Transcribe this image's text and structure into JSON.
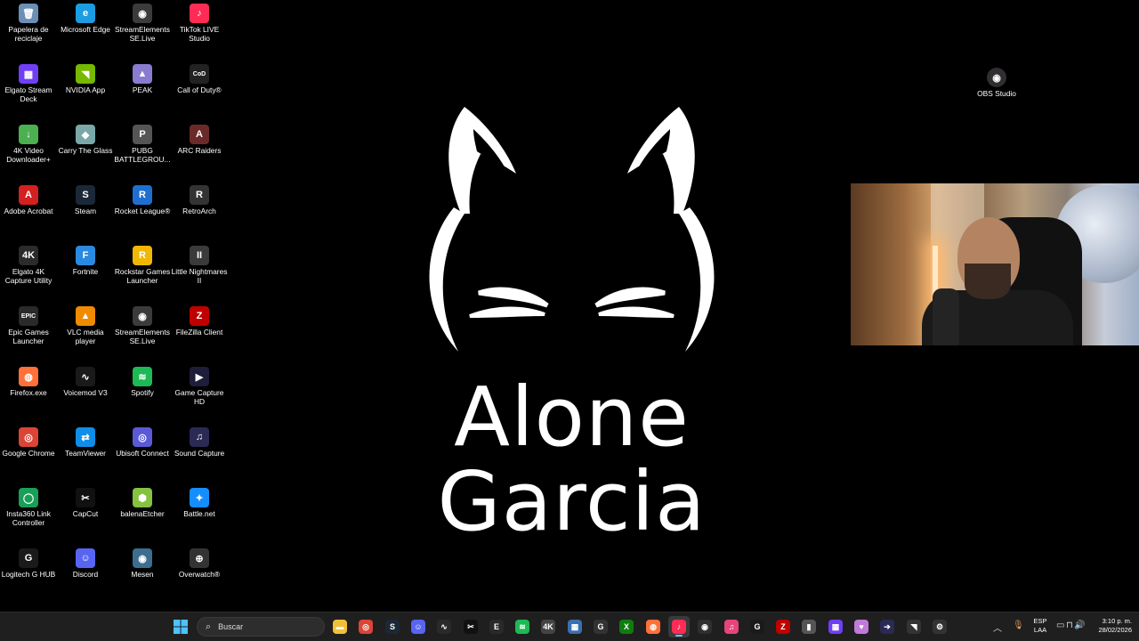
{
  "desktop": {
    "icons": [
      {
        "label": "Papelera de reciclaje",
        "icon": "recycle-bin-icon",
        "glyph": "🗑",
        "color": "#6b8fb5"
      },
      {
        "label": "Microsoft Edge",
        "icon": "edge-icon",
        "glyph": "e",
        "color": "#1b9de2"
      },
      {
        "label": "StreamElements SE.Live",
        "icon": "streamelements-icon",
        "glyph": "◉",
        "color": "#3b3b3b"
      },
      {
        "label": "TikTok LIVE Studio",
        "icon": "tiktok-live-icon",
        "glyph": "♪",
        "color": "#fe2c55"
      },
      {
        "label": "Elgato Stream Deck",
        "icon": "stream-deck-icon",
        "glyph": "▦",
        "color": "#6f3ff5"
      },
      {
        "label": "NVIDIA App",
        "icon": "nvidia-icon",
        "glyph": "◥",
        "color": "#76b900"
      },
      {
        "label": "PEAK",
        "icon": "peak-icon",
        "glyph": "▲",
        "color": "#8a7bd1"
      },
      {
        "label": "Call of Duty®",
        "icon": "call-of-duty-icon",
        "glyph": "CoD",
        "color": "#222222"
      },
      {
        "label": "4K Video Downloader+",
        "icon": "4k-video-downloader-icon",
        "glyph": "↓",
        "color": "#4caf50"
      },
      {
        "label": "Carry The Glass",
        "icon": "carry-the-glass-icon",
        "glyph": "◆",
        "color": "#7aa7a8"
      },
      {
        "label": "PUBG BATTLEGROU...",
        "icon": "pubg-icon",
        "glyph": "P",
        "color": "#555555"
      },
      {
        "label": "ARC Raiders",
        "icon": "arc-raiders-icon",
        "glyph": "A",
        "color": "#6b2a2a"
      },
      {
        "label": "Adobe Acrobat",
        "icon": "adobe-acrobat-icon",
        "glyph": "A",
        "color": "#d32020"
      },
      {
        "label": "Steam",
        "icon": "steam-icon",
        "glyph": "S",
        "color": "#1b2838"
      },
      {
        "label": "Rocket League®",
        "icon": "rocket-league-icon",
        "glyph": "R",
        "color": "#1f6fd1"
      },
      {
        "label": "RetroArch",
        "icon": "retroarch-icon",
        "glyph": "R",
        "color": "#333333"
      },
      {
        "label": "Elgato 4K Capture Utility",
        "icon": "elgato-capture-icon",
        "glyph": "4K",
        "color": "#2b2b2b"
      },
      {
        "label": "Fortnite",
        "icon": "fortnite-icon",
        "glyph": "F",
        "color": "#2a8ae0"
      },
      {
        "label": "Rockstar Games Launcher",
        "icon": "rockstar-icon",
        "glyph": "R",
        "color": "#f2b705"
      },
      {
        "label": "Little Nightmares II",
        "icon": "little-nightmares-icon",
        "glyph": "II",
        "color": "#3a3a3a"
      },
      {
        "label": "Epic Games Launcher",
        "icon": "epic-games-icon",
        "glyph": "EPIC",
        "color": "#2a2a2a"
      },
      {
        "label": "VLC media player",
        "icon": "vlc-icon",
        "glyph": "▲",
        "color": "#f08a00"
      },
      {
        "label": "StreamElements SE.Live",
        "icon": "streamelements-icon",
        "glyph": "◉",
        "color": "#3b3b3b"
      },
      {
        "label": "FileZilla Client",
        "icon": "filezilla-icon",
        "glyph": "Z",
        "color": "#bf0000"
      },
      {
        "label": "Firefox.exe",
        "icon": "firefox-icon",
        "glyph": "◍",
        "color": "#ff7139"
      },
      {
        "label": "Voicemod V3",
        "icon": "voicemod-icon",
        "glyph": "∿",
        "color": "#1a1a1a"
      },
      {
        "label": "Spotify",
        "icon": "spotify-icon",
        "glyph": "≋",
        "color": "#1db954"
      },
      {
        "label": "Game Capture HD",
        "icon": "game-capture-icon",
        "glyph": "▶",
        "color": "#1e1e3a"
      },
      {
        "label": "Google Chrome",
        "icon": "chrome-icon",
        "glyph": "◎",
        "color": "#db4437"
      },
      {
        "label": "TeamViewer",
        "icon": "teamviewer-icon",
        "glyph": "⇄",
        "color": "#0e8ee9"
      },
      {
        "label": "Ubisoft Connect",
        "icon": "ubisoft-icon",
        "glyph": "◎",
        "color": "#5a5ad6"
      },
      {
        "label": "Sound Capture",
        "icon": "sound-capture-icon",
        "glyph": "♫",
        "color": "#2a2a55"
      },
      {
        "label": "Insta360 Link Controller",
        "icon": "insta360-icon",
        "glyph": "◯",
        "color": "#18a058"
      },
      {
        "label": "CapCut",
        "icon": "capcut-icon",
        "glyph": "✂",
        "color": "#111111"
      },
      {
        "label": "balenaEtcher",
        "icon": "balena-etcher-icon",
        "glyph": "⬢",
        "color": "#85c240"
      },
      {
        "label": "Battle.net",
        "icon": "battlenet-icon",
        "glyph": "✦",
        "color": "#148eff"
      },
      {
        "label": "Logitech G HUB",
        "icon": "logitech-ghub-icon",
        "glyph": "G",
        "color": "#1a1a1a"
      },
      {
        "label": "Discord",
        "icon": "discord-icon",
        "glyph": "☺",
        "color": "#5865f2"
      },
      {
        "label": "Mesen",
        "icon": "mesen-icon",
        "glyph": "◉",
        "color": "#3c6e8f"
      },
      {
        "label": "Overwatch®",
        "icon": "overwatch-icon",
        "glyph": "⊕",
        "color": "#333333"
      }
    ],
    "obs": {
      "label": "OBS Studio",
      "icon": "obs-icon",
      "glyph": "◉",
      "color": "#302e31"
    }
  },
  "wallpaper": {
    "line1": "Alone",
    "line2": "Garcia"
  },
  "taskbar": {
    "search_placeholder": "Buscar",
    "apps": [
      {
        "name": "file-explorer-icon",
        "glyph": "▬",
        "color": "#f2c037"
      },
      {
        "name": "chrome-icon",
        "glyph": "◎",
        "color": "#db4437"
      },
      {
        "name": "steam-icon",
        "glyph": "S",
        "color": "#1b2838"
      },
      {
        "name": "discord-icon",
        "glyph": "☺",
        "color": "#5865f2"
      },
      {
        "name": "voicemod-icon",
        "glyph": "∿",
        "color": "#2a2a2a"
      },
      {
        "name": "capcut-icon",
        "glyph": "✂",
        "color": "#111111"
      },
      {
        "name": "epic-games-icon",
        "glyph": "E",
        "color": "#2a2a2a"
      },
      {
        "name": "spotify-icon",
        "glyph": "≋",
        "color": "#1db954"
      },
      {
        "name": "elgato-4k-icon",
        "glyph": "4K",
        "color": "#444444"
      },
      {
        "name": "multiviewer-icon",
        "glyph": "▦",
        "color": "#3a6fb0"
      },
      {
        "name": "g-app-icon",
        "glyph": "G",
        "color": "#333333"
      },
      {
        "name": "xbox-icon",
        "glyph": "X",
        "color": "#107c10"
      },
      {
        "name": "firefox-icon",
        "glyph": "◍",
        "color": "#ff7139"
      },
      {
        "name": "tiktok-live-icon",
        "glyph": "♪",
        "color": "#fe2c55"
      },
      {
        "name": "obs-icon",
        "glyph": "◉",
        "color": "#302e31"
      },
      {
        "name": "itunes-icon",
        "glyph": "♫",
        "color": "#e5457a"
      },
      {
        "name": "logitech-ghub-icon",
        "glyph": "G",
        "color": "#1a1a1a"
      },
      {
        "name": "filezilla-icon",
        "glyph": "Z",
        "color": "#bf0000"
      },
      {
        "name": "usb-drive-icon",
        "glyph": "▮",
        "color": "#555555"
      },
      {
        "name": "stream-deck-icon",
        "glyph": "▦",
        "color": "#6f3ff5"
      },
      {
        "name": "app-purple-icon",
        "glyph": "♥",
        "color": "#c07ad8"
      },
      {
        "name": "arrow-app-icon",
        "glyph": "➔",
        "color": "#2a2a55"
      },
      {
        "name": "nvidia-icon",
        "glyph": "◥",
        "color": "#333333"
      },
      {
        "name": "settings-app-icon",
        "glyph": "⚙",
        "color": "#333333"
      }
    ],
    "lang_line1": "ESP",
    "lang_line2": "LAA",
    "time": "3:10 p. m.",
    "date": "28/02/2026"
  }
}
